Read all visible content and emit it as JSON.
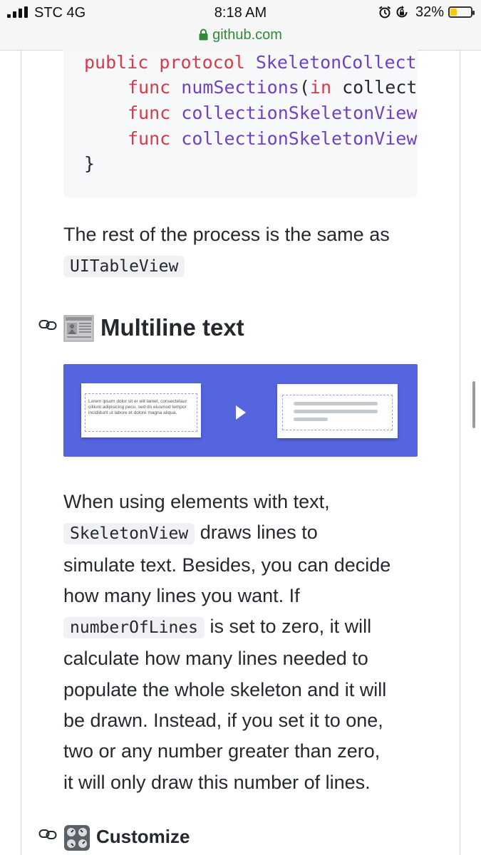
{
  "status_bar": {
    "carrier": "STC 4G",
    "time": "8:18 AM",
    "url": "github.com",
    "battery_percent": "32%",
    "battery_level": 0.32
  },
  "code": {
    "lines": [
      {
        "kw": "public protocol ",
        "ty": "SkeletonCollect",
        "pl": ""
      },
      {
        "kw": "func ",
        "ty": "numSections",
        "pl": "(",
        "kw2": "in",
        "pl2": " collect"
      },
      {
        "kw": "func ",
        "ty": "collectionSkeletonView",
        "pl": ""
      },
      {
        "kw": "func ",
        "ty": "collectionSkeletonView",
        "pl": ""
      },
      {
        "pl": "}"
      }
    ]
  },
  "paragraph1": {
    "text": "The rest of the process is the same as",
    "code": "UITableView"
  },
  "section_multiline": {
    "title": "Multiline text"
  },
  "illustration": {
    "lorem": "Lorem ipsum dolor sit er elit lamet, consectetaur cillium adipisicing pecu, sed do eiusmod tempor incididunt ut labore et dolore magna aliqua."
  },
  "paragraph2": {
    "t1": "When using elements with text,",
    "c1": "SkeletonView",
    "t2": "draws lines to",
    "t3": "simulate text. Besides, you can decide",
    "t4": "how many lines you want. If",
    "c2": "numberOfLines",
    "t5": "is set to zero, it will",
    "t6": "calculate how many lines needed to",
    "t7": "populate the whole skeleton and it will",
    "t8": "be drawn. Instead, if you set it to one,",
    "t9": "two or any number greater than zero,",
    "t10": "it will only draw this number of lines."
  },
  "section_customize": {
    "title": "Customize"
  },
  "icons": [
    "signal-icon",
    "lock-icon",
    "alarm-icon",
    "rotation-lock-icon",
    "battery-icon",
    "link-icon",
    "newspaper-icon",
    "control-knobs-icon"
  ]
}
